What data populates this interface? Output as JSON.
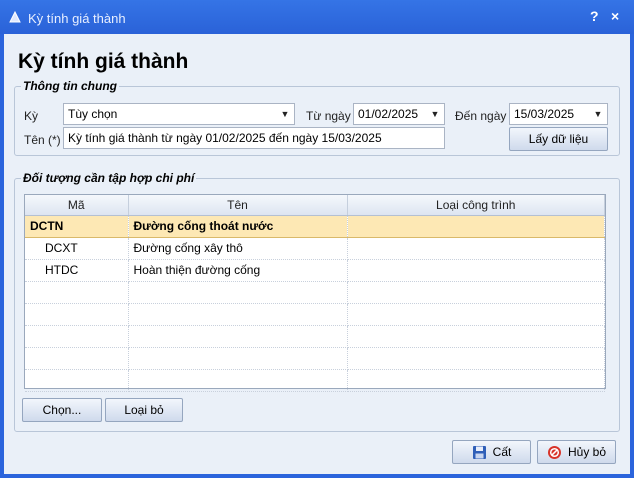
{
  "window": {
    "title": "Kỳ tính giá thành",
    "help_label": "?",
    "close_label": "×"
  },
  "heading": "Kỳ tính giá thành",
  "general": {
    "group_title": "Thông tin chung",
    "period_label": "Kỳ",
    "period_value": "Tùy chọn",
    "from_label": "Từ ngày",
    "from_value": "01/02/2025",
    "to_label": "Đến ngày",
    "to_value": "15/03/2025",
    "name_label": "Tên (*)",
    "name_value": "Kỳ tính giá thành từ ngày 01/02/2025 đến ngày 15/03/2025",
    "load_button": "Lấy dữ liệu"
  },
  "costing": {
    "group_title": "Đối tượng cần tập hợp chi phí",
    "columns": [
      "Mã",
      "Tên",
      "Loại công trình"
    ],
    "rows": [
      {
        "code": "DCTN",
        "name": "Đường cống thoát nước",
        "type": ""
      },
      {
        "code": "DCXT",
        "name": "Đường cống xây thô",
        "type": ""
      },
      {
        "code": "HTDC",
        "name": "Hoàn thiện đường cống",
        "type": ""
      }
    ],
    "select_button": "Chọn...",
    "remove_button": "Loại bỏ"
  },
  "footer": {
    "save_button": "Cất",
    "cancel_button": "Hủy bỏ"
  },
  "colors": {
    "titlebar": "#2a62d8",
    "client": "#eaf0f8",
    "selected_row": "#fde8b4"
  }
}
